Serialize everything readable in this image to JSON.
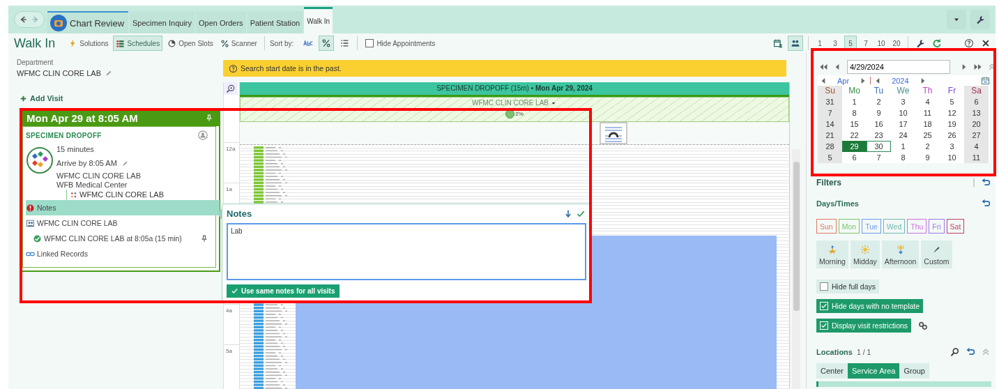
{
  "tabs": {
    "items": [
      {
        "label": "Chart Review",
        "kind": "home",
        "selected": false
      },
      {
        "label": "Specimen Inquiry",
        "kind": "plain",
        "selected": false
      },
      {
        "label": "Open Orders",
        "kind": "plain",
        "selected": false
      },
      {
        "label": "Patient Station",
        "kind": "plain",
        "selected": false
      },
      {
        "label": "Walk In",
        "kind": "plain",
        "selected": true
      }
    ]
  },
  "toolbar": {
    "title": "Walk In",
    "buttons": [
      {
        "label": "Solutions",
        "kind": "bolt",
        "selected": false
      },
      {
        "label": "Schedules",
        "kind": "grid",
        "selected": true
      },
      {
        "label": "Open Slots",
        "kind": "pie",
        "selected": false
      },
      {
        "label": "Scanner",
        "kind": "percent",
        "selected": false
      }
    ],
    "sort_label": "Sort by:",
    "sort_options": [
      {
        "kind": "abc",
        "selected": false
      },
      {
        "kind": "percent",
        "selected": true
      },
      {
        "kind": "list",
        "selected": false
      }
    ],
    "hide_appointments": {
      "label": "Hide Appointments",
      "checked": false
    },
    "day_counts": [
      {
        "label": "1",
        "selected": false
      },
      {
        "label": "3",
        "selected": false
      },
      {
        "label": "5",
        "selected": true
      },
      {
        "label": "7",
        "selected": false
      },
      {
        "label": "10",
        "selected": false
      },
      {
        "label": "20",
        "selected": false
      }
    ]
  },
  "department": {
    "label": "Department",
    "value": "WFMC CLIN CORE LAB"
  },
  "add_visit": "Add Visit",
  "visit_card": {
    "title": "Mon Apr 29 at 8:05 AM",
    "type": "SPECIMEN DROPOFF",
    "duration": "15 minutes",
    "arrive": "Arrive by 8:05 AM",
    "department": "WFMC CLIN CORE LAB",
    "center": "WFB Medical Center",
    "location": "WFMC CLIN CORE LAB",
    "rows": [
      {
        "kind": "notes",
        "label": "Notes",
        "selected": true
      },
      {
        "kind": "resource",
        "label": "WFMC CLIN CORE LAB",
        "selected": false
      },
      {
        "kind": "slot",
        "label": "WFMC CLIN CORE LAB at 8:05a (15 min)",
        "selected": false
      },
      {
        "kind": "link",
        "label": "Linked Records",
        "selected": false
      }
    ]
  },
  "schedule": {
    "banner": "Search start date is in the past.",
    "header": "SPECIMEN DROPOFF (15m) • **Mon Apr 29, 2024**",
    "location": "WFMC CLIN CORE LAB",
    "usage": "2%",
    "hours": [
      "12a",
      "1a",
      "4a",
      "5a"
    ]
  },
  "notes_popup": {
    "title": "Notes",
    "value": "Lab",
    "button": "Use same notes for all visits"
  },
  "calendar": {
    "date": "4/29/2024",
    "month": "Apr",
    "year": "2024",
    "weekdays": [
      {
        "label": "Su",
        "color": "#a0522d"
      },
      {
        "label": "Mo",
        "color": "#3a8a4a"
      },
      {
        "label": "Tu",
        "color": "#3a6fc0"
      },
      {
        "label": "We",
        "color": "#3f8f8a"
      },
      {
        "label": "Th",
        "color": "#c040c8"
      },
      {
        "label": "Fr",
        "color": "#7a4ae0"
      },
      {
        "label": "Sa",
        "color": "#a03050"
      }
    ],
    "weeks": [
      [
        {
          "day": "31",
          "selected": false,
          "outlined": false
        },
        {
          "day": "1",
          "selected": false,
          "outlined": false
        },
        {
          "day": "2",
          "selected": false,
          "outlined": false
        },
        {
          "day": "3",
          "selected": false,
          "outlined": false
        },
        {
          "day": "4",
          "selected": false,
          "outlined": false
        },
        {
          "day": "5",
          "selected": false,
          "outlined": false
        },
        {
          "day": "6",
          "selected": false,
          "outlined": false
        }
      ],
      [
        {
          "day": "7",
          "selected": false,
          "outlined": false
        },
        {
          "day": "8",
          "selected": false,
          "outlined": false
        },
        {
          "day": "9",
          "selected": false,
          "outlined": false
        },
        {
          "day": "10",
          "selected": false,
          "outlined": false
        },
        {
          "day": "11",
          "selected": false,
          "outlined": false
        },
        {
          "day": "12",
          "selected": false,
          "outlined": false
        },
        {
          "day": "13",
          "selected": false,
          "outlined": false
        }
      ],
      [
        {
          "day": "14",
          "selected": false,
          "outlined": false
        },
        {
          "day": "15",
          "selected": false,
          "outlined": false
        },
        {
          "day": "16",
          "selected": false,
          "outlined": false
        },
        {
          "day": "17",
          "selected": false,
          "outlined": false
        },
        {
          "day": "18",
          "selected": false,
          "outlined": false
        },
        {
          "day": "19",
          "selected": false,
          "outlined": false
        },
        {
          "day": "20",
          "selected": false,
          "outlined": false
        }
      ],
      [
        {
          "day": "21",
          "selected": false,
          "outlined": false
        },
        {
          "day": "22",
          "selected": false,
          "outlined": false
        },
        {
          "day": "23",
          "selected": false,
          "outlined": false
        },
        {
          "day": "24",
          "selected": false,
          "outlined": false
        },
        {
          "day": "25",
          "selected": false,
          "outlined": false
        },
        {
          "day": "26",
          "selected": false,
          "outlined": false
        },
        {
          "day": "27",
          "selected": false,
          "outlined": false
        }
      ],
      [
        {
          "day": "28",
          "selected": false,
          "outlined": false
        },
        {
          "day": "29",
          "selected": true,
          "outlined": false
        },
        {
          "day": "30",
          "selected": false,
          "outlined": true
        },
        {
          "day": "1",
          "selected": false,
          "outlined": false
        },
        {
          "day": "2",
          "selected": false,
          "outlined": false
        },
        {
          "day": "3",
          "selected": false,
          "outlined": false
        },
        {
          "day": "4",
          "selected": false,
          "outlined": false
        }
      ],
      [
        {
          "day": "5",
          "selected": false,
          "outlined": false
        },
        {
          "day": "6",
          "selected": false,
          "outlined": false
        },
        {
          "day": "7",
          "selected": false,
          "outlined": false
        },
        {
          "day": "8",
          "selected": false,
          "outlined": false
        },
        {
          "day": "9",
          "selected": false,
          "outlined": false
        },
        {
          "day": "10",
          "selected": false,
          "outlined": false
        },
        {
          "day": "11",
          "selected": false,
          "outlined": false
        }
      ]
    ]
  },
  "filters": {
    "title": "Filters",
    "days_title": "Days/Times",
    "days": [
      {
        "label": "Sun",
        "color": "#e07a5f"
      },
      {
        "label": "Mon",
        "color": "#7cc46a"
      },
      {
        "label": "Tue",
        "color": "#6a9be8"
      },
      {
        "label": "Wed",
        "color": "#6fb8b0"
      },
      {
        "label": "Thu",
        "color": "#d070e0"
      },
      {
        "label": "Fri",
        "color": "#9a7ae8"
      },
      {
        "label": "Sat",
        "color": "#c04060"
      }
    ],
    "times": [
      {
        "label": "Morning",
        "kind": "morning"
      },
      {
        "label": "Midday",
        "kind": "midday"
      },
      {
        "label": "Afternoon",
        "kind": "afternoon"
      },
      {
        "label": "Custom",
        "kind": "custom"
      }
    ],
    "options": [
      {
        "label": "Hide full days",
        "checked": false
      },
      {
        "label": "Hide days with no template",
        "checked": true
      },
      {
        "label": "Display visit restrictions",
        "checked": true
      }
    ],
    "locations": {
      "title": "Locations",
      "count": "1 / 1",
      "modes": [
        {
          "label": "Center",
          "selected": false
        },
        {
          "label": "Service Area",
          "selected": true
        },
        {
          "label": "Group",
          "selected": false
        }
      ]
    }
  },
  "red_frames": {
    "around_visit": true,
    "around_calendar": true
  }
}
